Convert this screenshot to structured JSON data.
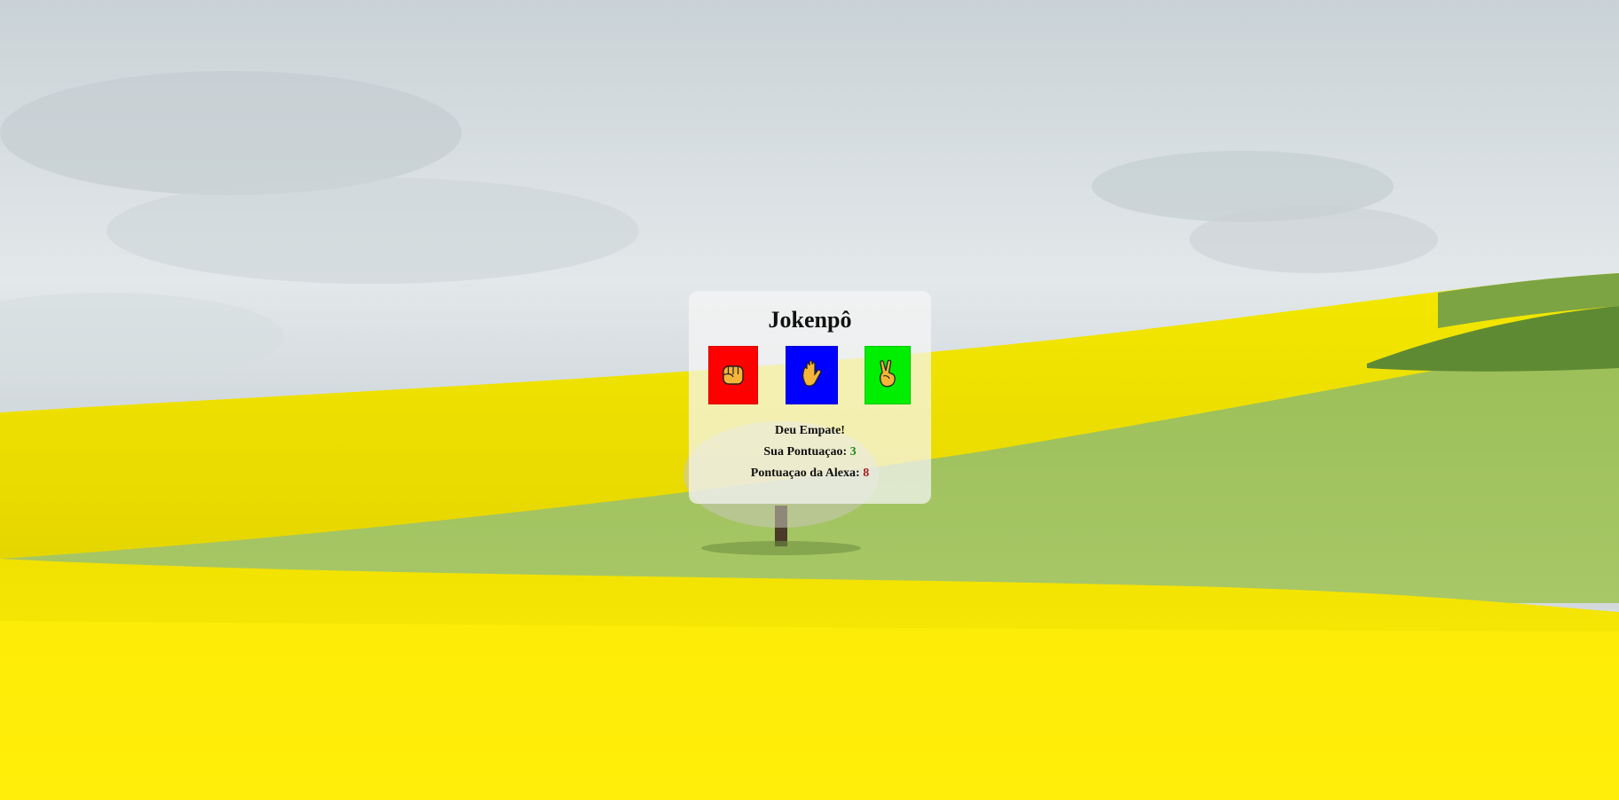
{
  "game": {
    "title": "Jokenpô",
    "result_text": "Deu Empate!",
    "user_score_label": "Sua Pontuaçao:",
    "user_score": "3",
    "alexa_score_label": "Pontuaçao da Alexa:",
    "alexa_score": "8"
  },
  "choices": [
    {
      "name": "rock",
      "icon": "fist-icon",
      "color": "#ff0000"
    },
    {
      "name": "paper",
      "icon": "open-hand-icon",
      "color": "#0000ff"
    },
    {
      "name": "scissors",
      "icon": "victory-hand-icon",
      "color": "#00ee00"
    }
  ],
  "colors": {
    "user_score": "#1a8a1a",
    "alexa_score": "#b01b1b",
    "card_background": "rgba(245,245,245,0.72)"
  }
}
